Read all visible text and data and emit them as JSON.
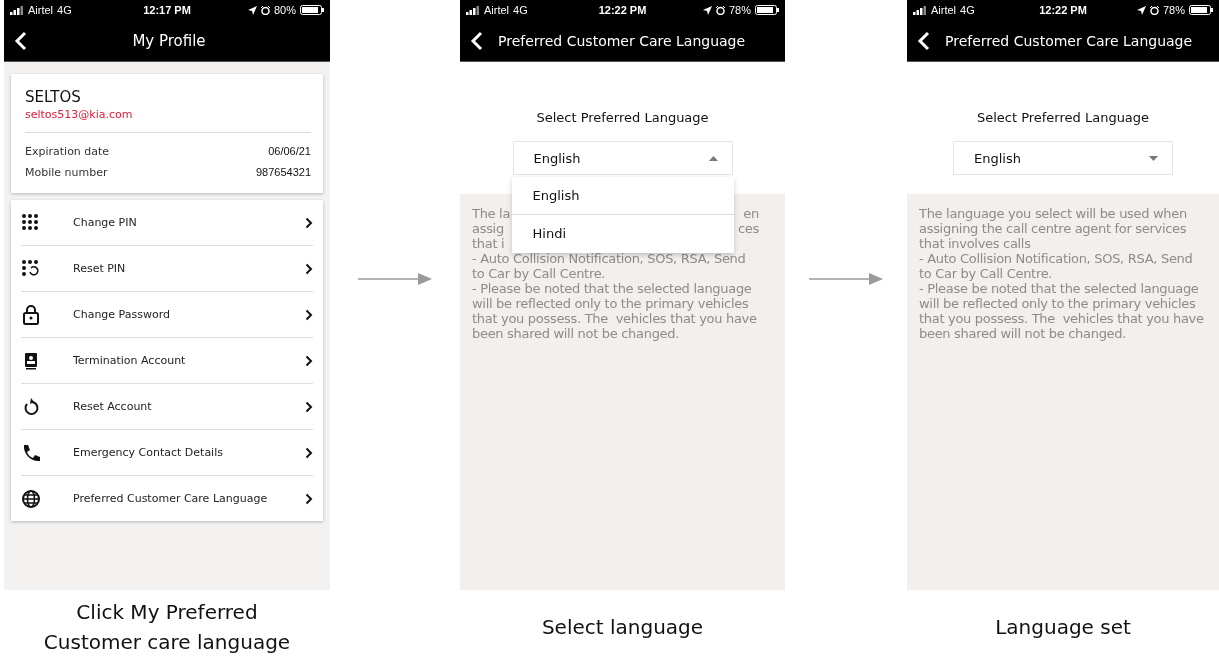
{
  "steps": [
    {
      "kind": "profile",
      "status_bar": {
        "carrier": "Airtel",
        "network": "4G",
        "time": "12:17 PM",
        "battery": "80%"
      },
      "header": {
        "title": "My Profile"
      },
      "profile": {
        "name": "SELTOS",
        "email": "seltos513@kia.com",
        "fields": [
          {
            "label": "Expiration date",
            "value": "06/06/21"
          },
          {
            "label": "Mobile number",
            "value": "987654321"
          }
        ]
      },
      "menu": [
        {
          "label": "Change PIN"
        },
        {
          "label": "Reset PIN"
        },
        {
          "label": "Change Password"
        },
        {
          "label": "Termination Account"
        },
        {
          "label": "Reset Account"
        },
        {
          "label": "Emergency Contact Details"
        },
        {
          "label": "Preferred Customer Care Language"
        }
      ],
      "caption": "Click My Preferred Customer care language"
    },
    {
      "kind": "language",
      "status_bar": {
        "carrier": "Airtel",
        "network": "4G",
        "time": "12:22 PM",
        "battery": "78%"
      },
      "header": {
        "title": "Preferred Customer Care Language"
      },
      "prompt": "Select Preferred Language",
      "dropdown": {
        "value": "English",
        "expanded": true,
        "options": [
          {
            "label": "English"
          },
          {
            "label": "Hindi"
          }
        ]
      },
      "notice": {
        "fragments": [
          [
            "The la",
            "en"
          ],
          [
            "assig",
            "ces"
          ],
          [
            "that i"
          ]
        ],
        "text": "- Auto Collision Notification, SOS, RSA, Send to Car by Call Centre.\n- Please be noted that the selected language will be reflected only to the primary vehicles that you possess. The  vehicles that you have been shared will not be changed."
      },
      "caption": "Select language"
    },
    {
      "kind": "language",
      "status_bar": {
        "carrier": "Airtel",
        "network": "4G",
        "time": "12:22 PM",
        "battery": "78%"
      },
      "header": {
        "title": "Preferred Customer Care Language"
      },
      "prompt": "Select Preferred Language",
      "dropdown": {
        "value": "English",
        "expanded": false
      },
      "notice": {
        "text": "The language you select will be used when assigning the call centre agent for services that involves calls\n- Auto Collision Notification, SOS, RSA, Send to Car by Call Centre.\n- Please be noted that the selected language will be reflected only to the primary vehicles that you possess. The  vehicles that you have been shared will not be changed."
      },
      "caption": "Language set"
    }
  ]
}
